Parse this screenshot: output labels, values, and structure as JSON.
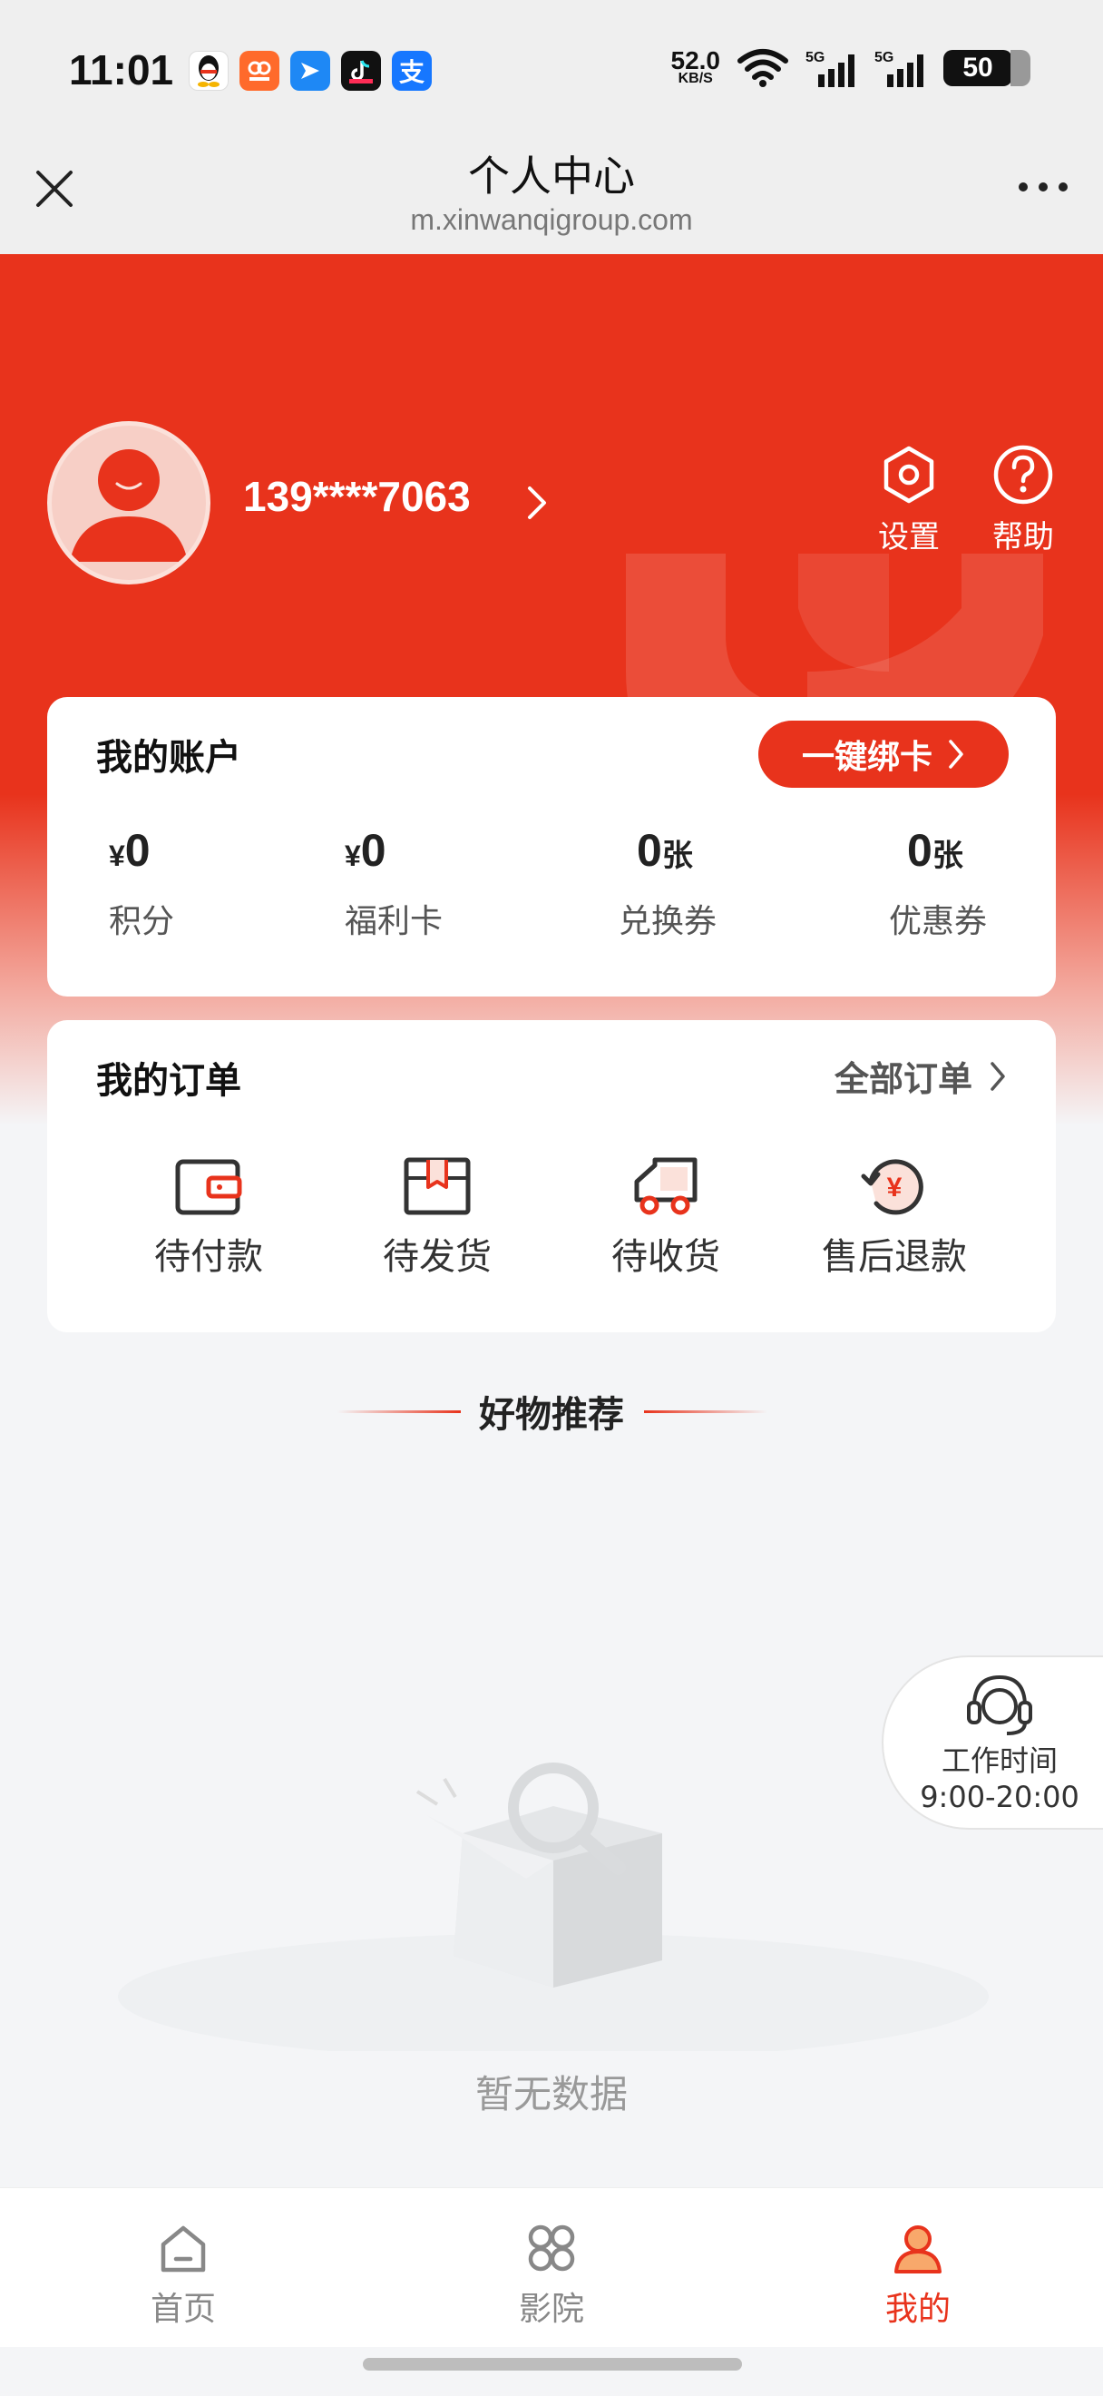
{
  "status_bar": {
    "time": "11:01",
    "net_speed": "52.0",
    "net_unit": "KB/S",
    "battery": "50",
    "app_icons": [
      "qq-icon",
      "app-orange-icon",
      "bird-icon",
      "tiktok-icon",
      "alipay-icon"
    ]
  },
  "nav": {
    "title": "个人中心",
    "url": "m.xinwanqigroup.com"
  },
  "profile": {
    "phone": "139****7063",
    "settings_label": "设置",
    "help_label": "帮助"
  },
  "account": {
    "title": "我的账户",
    "bind_button": "一键绑卡",
    "items": [
      {
        "prefix": "¥",
        "value": "0",
        "suffix": "",
        "label": "积分"
      },
      {
        "prefix": "¥",
        "value": "0",
        "suffix": "",
        "label": "福利卡"
      },
      {
        "prefix": "",
        "value": "0",
        "suffix": "张",
        "label": "兑换券"
      },
      {
        "prefix": "",
        "value": "0",
        "suffix": "张",
        "label": "优惠券"
      }
    ]
  },
  "orders": {
    "title": "我的订单",
    "all_orders": "全部订单",
    "items": [
      {
        "label": "待付款",
        "icon": "wallet-icon"
      },
      {
        "label": "待发货",
        "icon": "box-icon"
      },
      {
        "label": "待收货",
        "icon": "truck-icon"
      },
      {
        "label": "售后退款",
        "icon": "refund-icon"
      }
    ]
  },
  "recommend": {
    "title": "好物推荐",
    "empty_text": "暂无数据"
  },
  "service": {
    "line1": "工作时间",
    "line2": "9:00-20:00"
  },
  "tabbar": {
    "items": [
      {
        "label": "首页",
        "icon": "home-icon",
        "active": false
      },
      {
        "label": "影院",
        "icon": "cinema-icon",
        "active": false
      },
      {
        "label": "我的",
        "icon": "user-icon",
        "active": true
      }
    ]
  },
  "colors": {
    "brand_red": "#e8331c",
    "background": "#f4f5f7"
  }
}
